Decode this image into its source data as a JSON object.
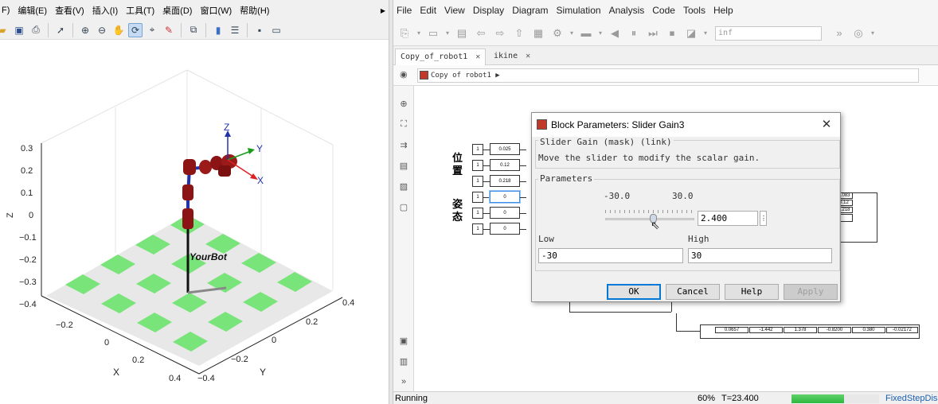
{
  "figure": {
    "menu": [
      "F)",
      "编辑(E)",
      "查看(V)",
      "插入(I)",
      "工具(T)",
      "桌面(D)",
      "窗口(W)",
      "帮助(H)"
    ],
    "toolbar_icons": [
      "open-icon",
      "save-icon",
      "print-icon",
      "pointer-icon",
      "zoom-in-icon",
      "zoom-out-icon",
      "pan-icon",
      "rotate-icon",
      "data-cursor-icon",
      "brush-icon",
      "link-icon",
      "colorbar-icon",
      "legend-icon",
      "hide-plot-tools-icon",
      "show-plot-tools-icon"
    ],
    "axes": {
      "z_ticks": [
        "0.3",
        "0.2",
        "0.1",
        "0",
        "−0.1",
        "−0.2",
        "−0.3",
        "−0.4"
      ],
      "x_ticks": [
        "−0.2",
        "0",
        "0.2",
        "0.4"
      ],
      "y_ticks": [
        "0.4",
        "0.2",
        "0",
        "−0.2",
        "−0.4"
      ],
      "xlabel": "X",
      "ylabel": "Y",
      "zlabel": "Z",
      "frame_labels": {
        "x": "X",
        "y": "Y",
        "z": "Z"
      },
      "robot_name": "YourBot",
      "floor_colors": [
        "#79e479",
        "#e8e8e8"
      ]
    }
  },
  "simulink": {
    "menu": [
      "File",
      "Edit",
      "View",
      "Display",
      "Diagram",
      "Simulation",
      "Analysis",
      "Code",
      "Tools",
      "Help"
    ],
    "stop_time": "inf",
    "tabs": [
      {
        "label": "Copy_of_robot1",
        "close": "✕"
      },
      {
        "label": "ikine",
        "close": "✕"
      }
    ],
    "breadcrumb": "Copy of robot1",
    "labels": {
      "position": "位置",
      "attitude": "姿态"
    },
    "block_values": [
      "0.025",
      "0.12",
      "0.218",
      "0",
      "0",
      "0"
    ],
    "source_const": "1",
    "right_display": [
      "0.083",
      "0.12",
      "0.218"
    ],
    "output_display": [
      "0.0657",
      "-1.442",
      "1.378",
      "-0.8200",
      "0.380",
      "-0.02172"
    ],
    "status": {
      "state": "Running",
      "progress_percent": 60,
      "progress_text": "60%",
      "time": "T=23.400",
      "solver": "FixedStepDis"
    }
  },
  "dialog": {
    "title": "Block Parameters: Slider Gain3",
    "mask_header": "Slider Gain (mask) (link)",
    "description": "Move the slider to modify the scalar gain.",
    "parameters_label": "Parameters",
    "range_min": "-30.0",
    "range_max": "30.0",
    "gain_value": "2.400",
    "slider_fraction": 0.54,
    "low_label": "Low",
    "high_label": "High",
    "low_value": "-30",
    "high_value": "30",
    "buttons": {
      "ok": "OK",
      "cancel": "Cancel",
      "help": "Help",
      "apply": "Apply"
    }
  }
}
